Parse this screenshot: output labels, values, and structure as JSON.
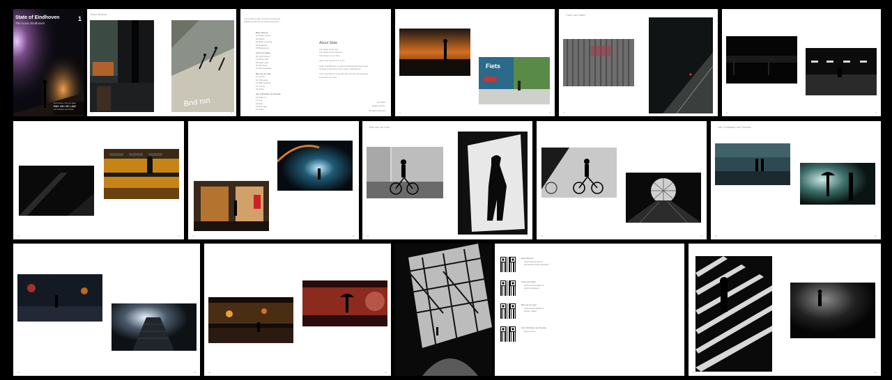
{
  "cover": {
    "title": "State of Eindhoven",
    "subtitle": "The Iconic Eindhoven",
    "number": "1",
    "band_line1": "Bram Bosma, Chris van Dalen",
    "band_line2": "Bas van de Laar",
    "band_line3": "Jan Christiaan van Snoeke"
  },
  "spread1": {
    "header": "Bram Bosma"
  },
  "toc": {
    "top_line1": "Lorem ipsum dolor sit amet consectetur",
    "top_line2": "Adipiscing elit sed do eiusmod tempor",
    "groups": [
      {
        "name": "Bram Bosma",
        "items": [
          "01 Street scene",
          "02 Pillars",
          "03 Night crossing",
          "04 Shadows",
          "05 Reflections"
        ]
      },
      {
        "name": "Chris van Dalen",
        "items": [
          "06 Light tunnel",
          "07 Glass wall",
          "08 Night road",
          "09 Windows",
          "10 Dark passage"
        ]
      },
      {
        "name": "Bas van de Laar",
        "items": [
          "11 Cyclist",
          "12 Silhouette",
          "13 Wall shadow",
          "14 Tunnel",
          "15 Stairs"
        ]
      },
      {
        "name": "Jan Christiaan van Snoeke",
        "items": [
          "16 Platform",
          "17 Fog",
          "18 Rain",
          "19 Red light",
          "20 Stairs"
        ]
      }
    ],
    "about_title": "About State",
    "about_lines": [
      "The State of the City",
      "The Mode of the Streets",
      "The Street of our Time",
      "",
      "Just a few words for it to be",
      "",
      "State of Eindhoven is about presenting the best work",
      "designers that have been close to Eindhoven",
      "",
      "The inspiration is found all work and the photography",
      "is around your own"
    ],
    "footer1": "July 2023",
    "footer2": "Digital version",
    "footer3": "All rights reserved"
  },
  "spread3": {
    "header": "Chris van Dalen"
  },
  "spread5": {
    "header": "Bas van de Laar"
  },
  "spread6": {
    "header": "Jan Christiaan van Snoeke"
  },
  "contacts": [
    {
      "name": "Bram Bosma",
      "lines": [
        "www.brambosma.nl",
        "@brambosmaphotography"
      ]
    },
    {
      "name": "Chris van Dalen",
      "lines": [
        "www.chrisvandalen.nl",
        "@chrisvandalen"
      ]
    },
    {
      "name": "Bas van de Laar",
      "lines": [
        "www.basvandelaar.nl",
        "@bas_vdlaar"
      ]
    },
    {
      "name": "Jan Christiaan van Snoeke",
      "lines": [
        "@jcvs.photo"
      ]
    }
  ],
  "page_numbers": [
    "2",
    "3",
    "4",
    "5",
    "6",
    "7",
    "8",
    "9",
    "10",
    "11",
    "12",
    "13",
    "14",
    "15",
    "16",
    "17",
    "18",
    "19",
    "20",
    "21",
    "22",
    "23",
    "24",
    "25",
    "26",
    "27",
    "28",
    "29",
    "30"
  ],
  "colors": {
    "background": "#000000",
    "page": "#ffffff",
    "cover_title": "#ffffff",
    "accent_orange": "#c8781e"
  }
}
